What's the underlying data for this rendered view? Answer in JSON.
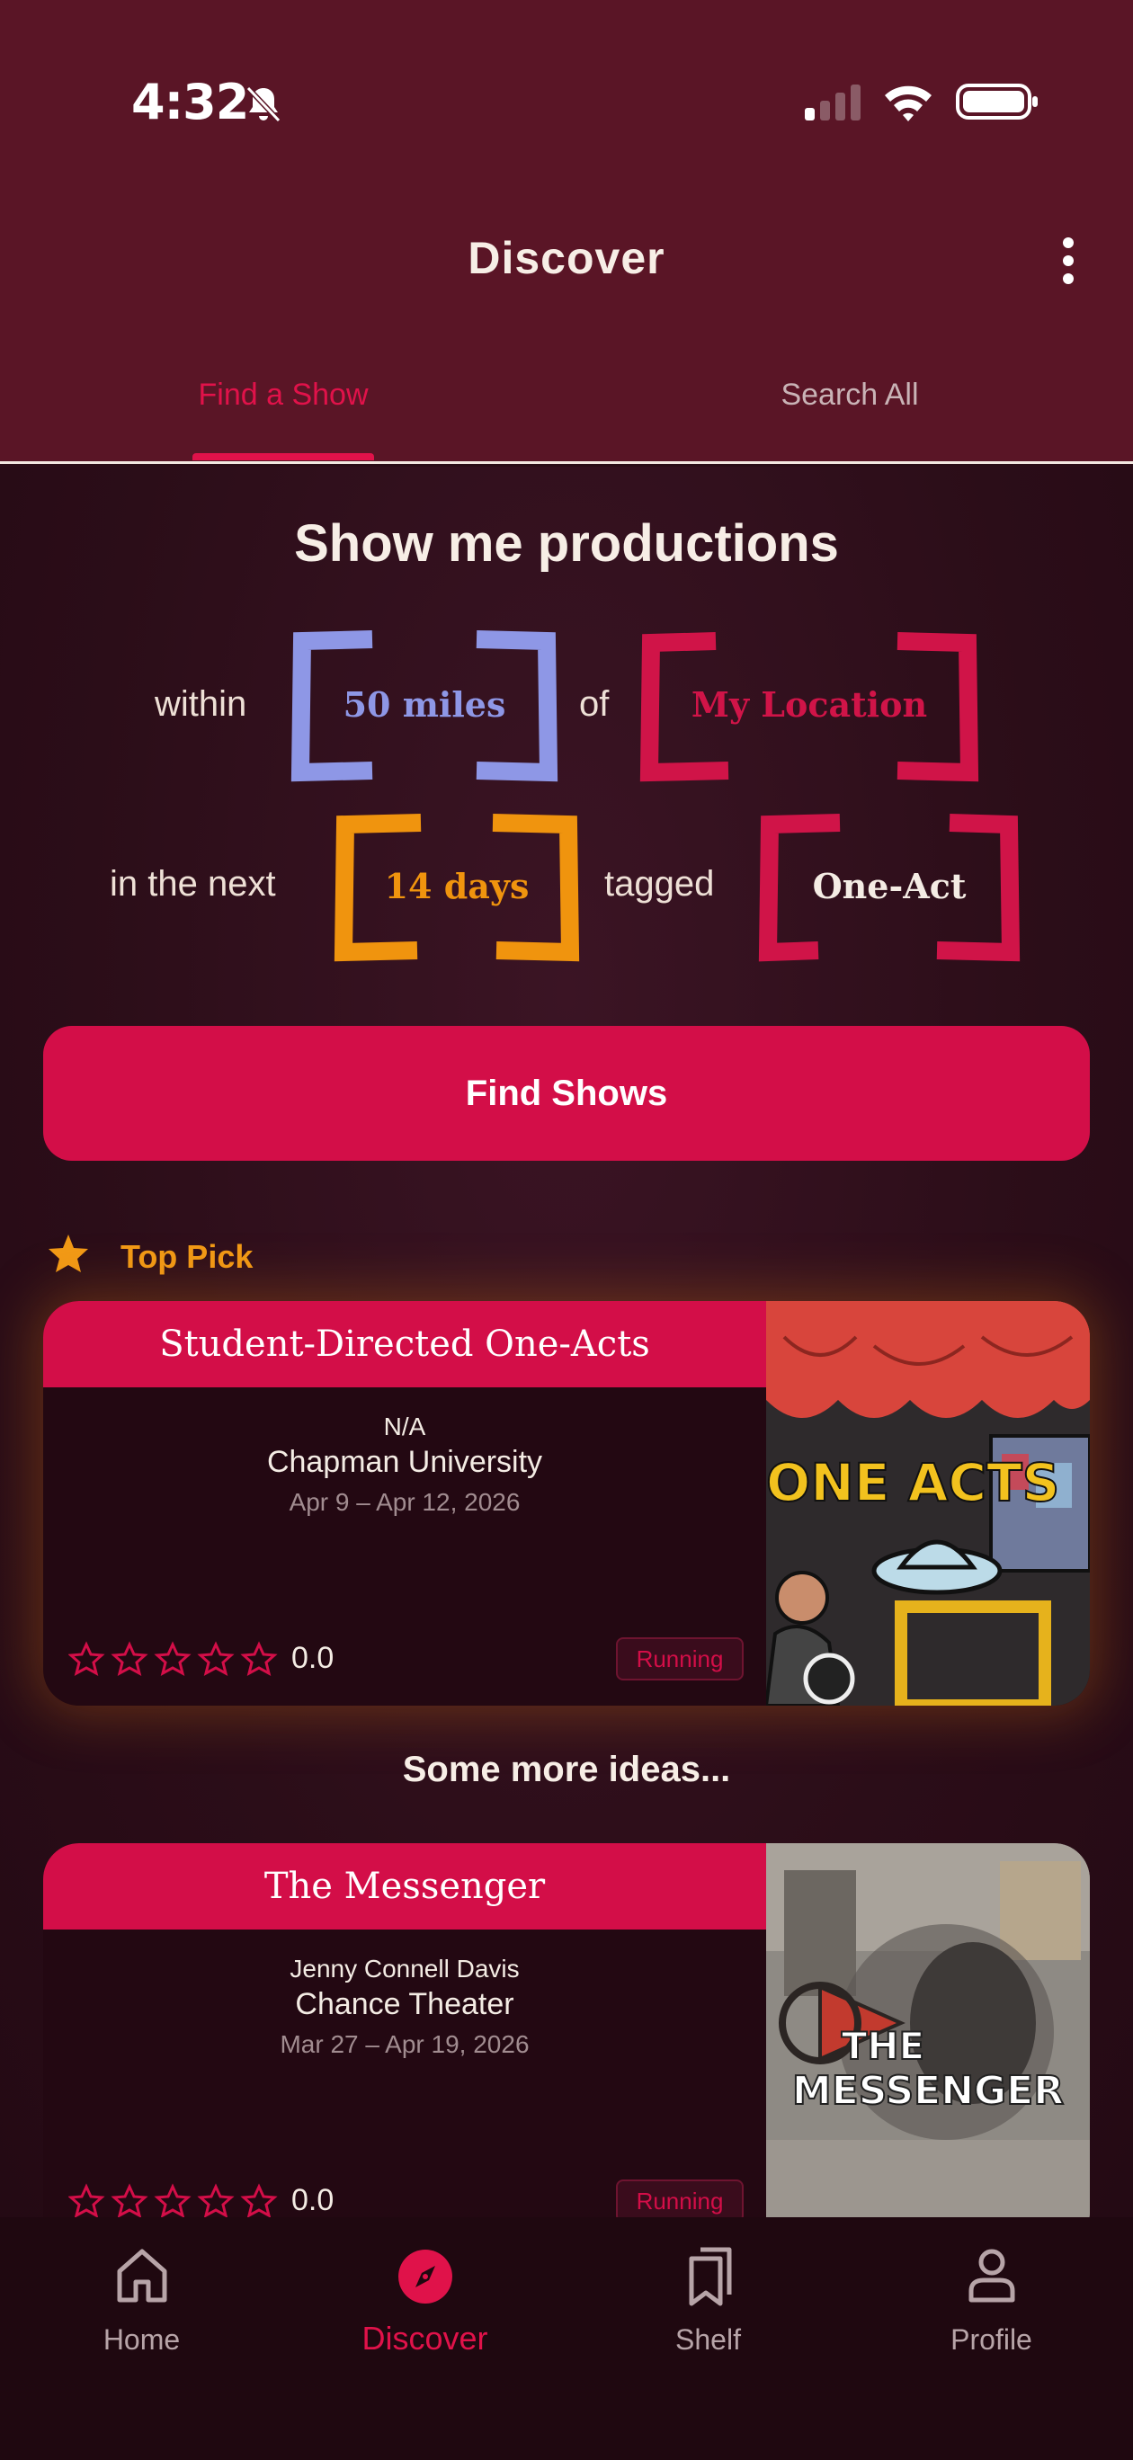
{
  "status_bar": {
    "time": "4:32"
  },
  "header": {
    "title": "Discover"
  },
  "tabs": [
    {
      "label": "Find a Show",
      "active": true
    },
    {
      "label": "Search All",
      "active": false
    }
  ],
  "finder": {
    "headline": "Show me productions",
    "within_label": "within",
    "distance_value": "50 miles",
    "of_label": "of",
    "location_value": "My Location",
    "next_label": "in the next",
    "days_value": "14 days",
    "tagged_label": "tagged",
    "tag_value": "One-Act",
    "colors": {
      "distance": "#8e97e6",
      "location": "#d01448",
      "days": "#f0940e",
      "tag": "#d01448"
    },
    "find_button_label": "Find Shows"
  },
  "top_pick": {
    "label": "Top Pick",
    "title": "Student-Directed One-Acts",
    "director": "N/A",
    "venue": "Chapman University",
    "dates": "Apr 9 – Apr 12, 2026",
    "rating": "0.0",
    "stars_filled": 0,
    "stars_total": 5,
    "status": "Running",
    "poster_text": "ONE ACTS"
  },
  "more_ideas_label": "Some more ideas...",
  "ideas": [
    {
      "title": "The Messenger",
      "director": "Jenny Connell Davis",
      "venue": "Chance Theater",
      "dates": "Mar 27 – Apr 19, 2026",
      "rating": "0.0",
      "stars_filled": 0,
      "stars_total": 5,
      "status": "Running",
      "poster_line1": "THE",
      "poster_line2": "MESSENGER"
    }
  ],
  "bottom_nav": [
    {
      "label": "Home",
      "icon": "home-icon",
      "active": false
    },
    {
      "label": "Discover",
      "icon": "compass-icon",
      "active": true
    },
    {
      "label": "Shelf",
      "icon": "bookmarks-icon",
      "active": false
    },
    {
      "label": "Profile",
      "icon": "person-icon",
      "active": false
    }
  ],
  "colors": {
    "header_bg": "#5a1526",
    "accent": "#d30e48",
    "page_bg": "#2a0d17",
    "top_pick_gold": "#f29a16"
  }
}
